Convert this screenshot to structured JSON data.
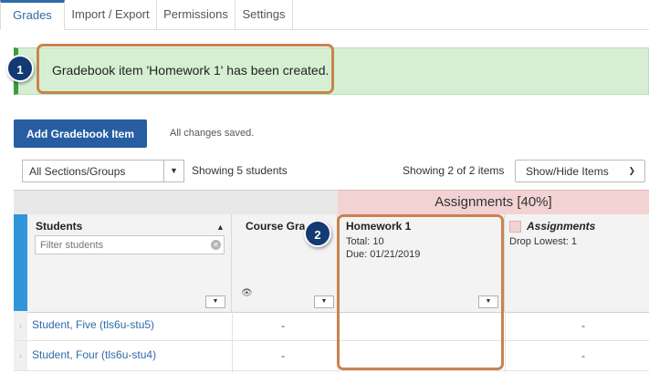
{
  "tabs": [
    {
      "label": "Grades",
      "active": true
    },
    {
      "label": "Import / Export",
      "active": false
    },
    {
      "label": "Permissions",
      "active": false
    },
    {
      "label": "Settings",
      "active": false
    }
  ],
  "banner": {
    "message": "Gradebook item 'Homework 1' has been created."
  },
  "callouts": [
    "1",
    "2"
  ],
  "toolbar": {
    "add_item_label": "Add Gradebook Item",
    "saved_status": "All changes saved.",
    "section_select": "All Sections/Groups",
    "showing_students": "Showing 5 students",
    "showing_items": "Showing 2 of 2 items",
    "show_hide_label": "Show/Hide Items"
  },
  "grid": {
    "category_header": "Assignments [40%]",
    "students_col": {
      "title": "Students",
      "filter_placeholder": "Filter students"
    },
    "course_grade_col": {
      "title": "Course Gra"
    },
    "homework_col": {
      "title": "Homework 1",
      "total": "Total: 10",
      "due": "Due: 01/21/2019"
    },
    "category_col": {
      "title": "Assignments",
      "drop": "Drop Lowest: 1"
    },
    "rows": [
      {
        "student": "Student, Five (tls6u-stu5)",
        "course_grade": "-",
        "homework": "",
        "category": "-"
      },
      {
        "student": "Student, Four (tls6u-stu4)",
        "course_grade": "-",
        "homework": "",
        "category": "-"
      }
    ]
  },
  "colors": {
    "accent": "#275ea2",
    "banner_bg": "#d6efd3",
    "callout": "#c9834d",
    "category": "#f2d2d2"
  }
}
